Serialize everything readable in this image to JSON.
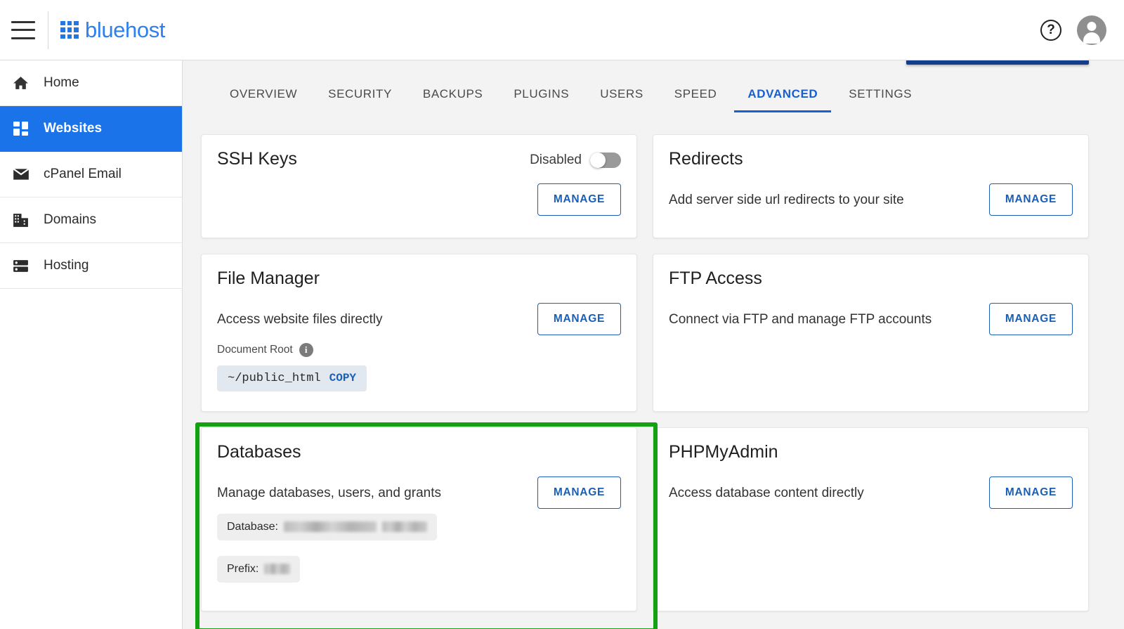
{
  "header": {
    "menu_icon": "hamburger-menu-icon",
    "brand": "bluehost",
    "help_icon": "?",
    "help_name": "help-icon",
    "avatar_name": "user-avatar"
  },
  "sidebar": {
    "items": [
      {
        "label": "Home",
        "icon": "home-icon",
        "active": false
      },
      {
        "label": "Websites",
        "icon": "dashboard-grid-icon",
        "active": true
      },
      {
        "label": "cPanel Email",
        "icon": "envelope-icon",
        "active": false
      },
      {
        "label": "Domains",
        "icon": "building-icon",
        "active": false
      },
      {
        "label": "Hosting",
        "icon": "server-rack-icon",
        "active": false
      }
    ]
  },
  "tabs": [
    {
      "label": "OVERVIEW",
      "active": false
    },
    {
      "label": "SECURITY",
      "active": false
    },
    {
      "label": "BACKUPS",
      "active": false
    },
    {
      "label": "PLUGINS",
      "active": false
    },
    {
      "label": "USERS",
      "active": false
    },
    {
      "label": "SPEED",
      "active": false
    },
    {
      "label": "ADVANCED",
      "active": true
    },
    {
      "label": "SETTINGS",
      "active": false
    }
  ],
  "cards": {
    "ssh_keys": {
      "title": "SSH Keys",
      "toggle_label": "Disabled",
      "toggle_state": "off",
      "manage_label": "MANAGE"
    },
    "redirects": {
      "title": "Redirects",
      "description": "Add server side url redirects to your site",
      "manage_label": "MANAGE"
    },
    "file_manager": {
      "title": "File Manager",
      "description": "Access website files directly",
      "document_root_label": "Document Root",
      "info_icon": "i",
      "document_root_value": "~/public_html",
      "copy_label": "COPY",
      "manage_label": "MANAGE"
    },
    "ftp_access": {
      "title": "FTP Access",
      "description": "Connect via FTP and manage FTP accounts",
      "manage_label": "MANAGE"
    },
    "databases": {
      "title": "Databases",
      "description": "Manage databases, users, and grants",
      "database_label": "Database:",
      "database_value": "",
      "prefix_label": "Prefix:",
      "prefix_value": "",
      "manage_label": "MANAGE",
      "highlighted": true
    },
    "phpmyadmin": {
      "title": "PHPMyAdmin",
      "description": "Access database content directly",
      "manage_label": "MANAGE"
    }
  },
  "colors": {
    "brand_blue": "#2f80ed",
    "active_sidebar": "#1a73e8",
    "link_blue": "#1a5fb4",
    "tab_active": "#1a5fd0",
    "highlight_green": "#11a111",
    "cut_button": "#143e8c",
    "content_bg": "#f3f3f3"
  }
}
